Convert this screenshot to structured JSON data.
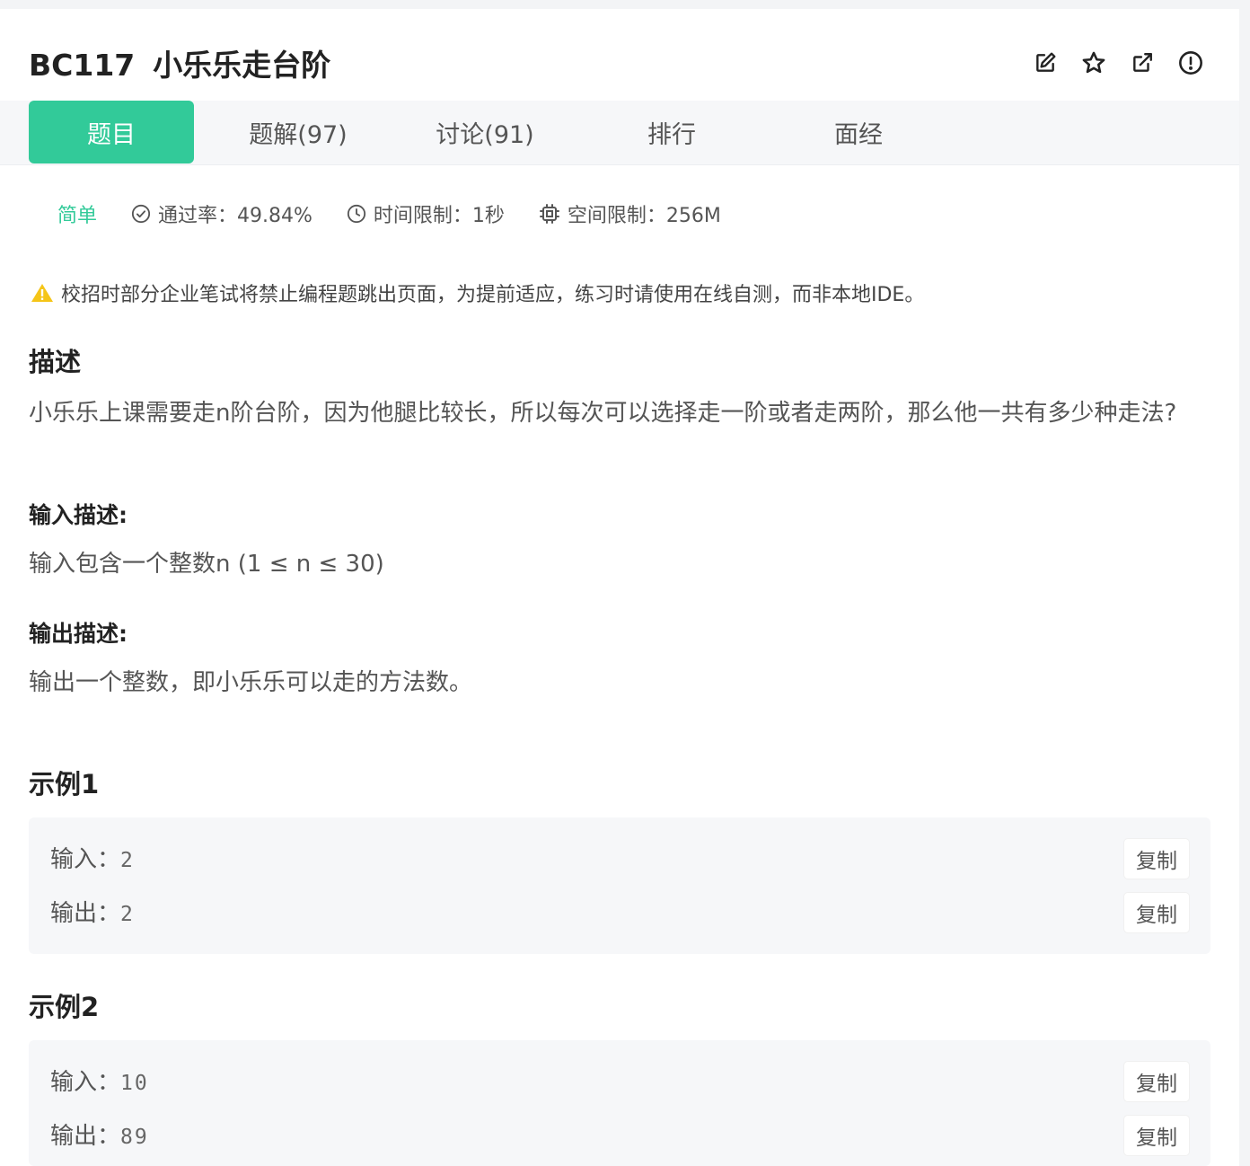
{
  "problem": {
    "id": "BC117",
    "name": "小乐乐走台阶"
  },
  "tabs": [
    {
      "label": "题目"
    },
    {
      "label": "题解(97)"
    },
    {
      "label": "讨论(91)"
    },
    {
      "label": "排行"
    },
    {
      "label": "面经"
    }
  ],
  "meta": {
    "level": "简单",
    "pass_rate": "通过率：49.84%",
    "time_limit": "时间限制：1秒",
    "space_limit": "空间限制：256M"
  },
  "notice": "校招时部分企业笔试将禁止编程题跳出页面，为提前适应，练习时请使用在线自测，而非本地IDE。",
  "description": {
    "heading": "描述",
    "text": "小乐乐上课需要走n阶台阶，因为他腿比较长，所以每次可以选择走一阶或者走两阶，那么他一共有多少种走法?"
  },
  "input_desc": {
    "heading": "输入描述:",
    "text": "输入包含一个整数n (1 ≤ n ≤ 30)"
  },
  "output_desc": {
    "heading": "输出描述:",
    "text": "输出一个整数，即小乐乐可以走的方法数。"
  },
  "examples": [
    {
      "heading": "示例1",
      "input_label": "输入：",
      "input": "2",
      "output_label": "输出：",
      "output": "2",
      "copy_label": "复制"
    },
    {
      "heading": "示例2",
      "input_label": "输入：",
      "input": "10",
      "output_label": "输出：",
      "output": "89",
      "copy_label": "复制"
    }
  ],
  "colors": {
    "accent": "#32ca99",
    "warning": "#f5c518"
  },
  "icons": [
    "edit-icon",
    "star-icon",
    "external-link-icon",
    "report-icon",
    "check-circle-icon",
    "clock-icon",
    "chip-icon",
    "warning-icon"
  ]
}
